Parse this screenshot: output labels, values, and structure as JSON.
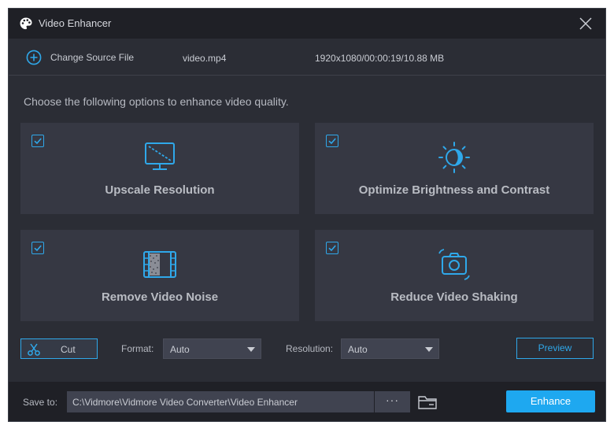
{
  "window": {
    "title": "Video Enhancer",
    "title_icon": "palette-icon",
    "close_icon": "close-icon"
  },
  "source": {
    "button_label": "Change Source File",
    "button_icon": "plus-circle-icon",
    "file_name": "video.mp4",
    "file_info": "1920x1080/00:00:19/10.88 MB"
  },
  "instruction": "Choose the following options to enhance video quality.",
  "options": [
    {
      "label": "Upscale Resolution",
      "checked": true,
      "icon": "monitor-icon"
    },
    {
      "label": "Optimize Brightness and Contrast",
      "checked": true,
      "icon": "brightness-icon"
    },
    {
      "label": "Remove Video Noise",
      "checked": true,
      "icon": "film-noise-icon"
    },
    {
      "label": "Reduce Video Shaking",
      "checked": true,
      "icon": "camera-stabilize-icon"
    }
  ],
  "controls": {
    "cut_label": "Cut",
    "format_label": "Format:",
    "format_value": "Auto",
    "resolution_label": "Resolution:",
    "resolution_value": "Auto",
    "preview_label": "Preview"
  },
  "bottom": {
    "save_label": "Save to:",
    "save_path": "C:\\Vidmore\\Vidmore Video Converter\\Video Enhancer",
    "browse_label": "···",
    "enhance_label": "Enhance"
  },
  "colors": {
    "accent": "#1ea8f0",
    "background": "#2b2d35",
    "card": "#363843",
    "titlebar": "#1f2026"
  }
}
